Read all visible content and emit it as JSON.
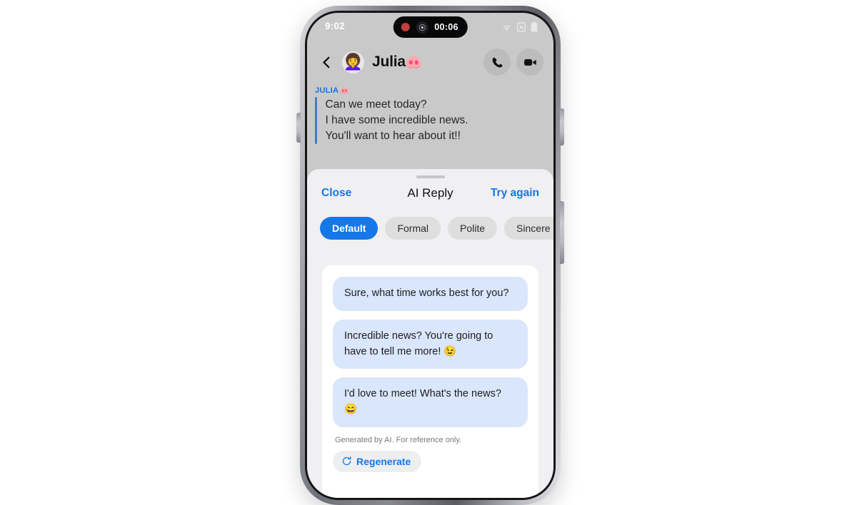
{
  "status_bar": {
    "time": "9:02",
    "recording_timer": "00:06",
    "icons": [
      "wifi-icon",
      "sim-off-icon",
      "battery-icon"
    ]
  },
  "conversation_header": {
    "back_icon": "back-chevron-icon",
    "avatar_emoji": "👩‍🦱",
    "contact_name": "Julia",
    "contact_name_emoji": "🐽",
    "call_icon": "phone-call-icon",
    "video_icon": "video-call-icon"
  },
  "thread": {
    "sender_label": "JULIA",
    "sender_label_emoji": "🐽",
    "message_lines": [
      "Can we meet today?",
      "I have some incredible news.",
      "You'll want to hear about it!!"
    ]
  },
  "sheet": {
    "close_label": "Close",
    "title": "AI Reply",
    "try_again_label": "Try again",
    "tone_chips": [
      {
        "label": "Default",
        "selected": true
      },
      {
        "label": "Formal",
        "selected": false
      },
      {
        "label": "Polite",
        "selected": false
      },
      {
        "label": "Sincere",
        "selected": false
      },
      {
        "label": "",
        "selected": false
      }
    ],
    "suggestions": [
      "Sure, what time works best for you?",
      "Incredible news? You're going to have to tell me more! 😉",
      "I'd love to meet! What's the news? 😄"
    ],
    "disclaimer": "Generated by AI. For reference only.",
    "regenerate_label": "Regenerate",
    "regenerate_icon": "refresh-icon"
  },
  "colors": {
    "accent_blue": "#1677e8",
    "bubble_blue": "#d9e6fb",
    "sheet_bg": "#f0f0f2",
    "screen_bg": "#c9c9c9",
    "chip_bg": "#dededf"
  }
}
